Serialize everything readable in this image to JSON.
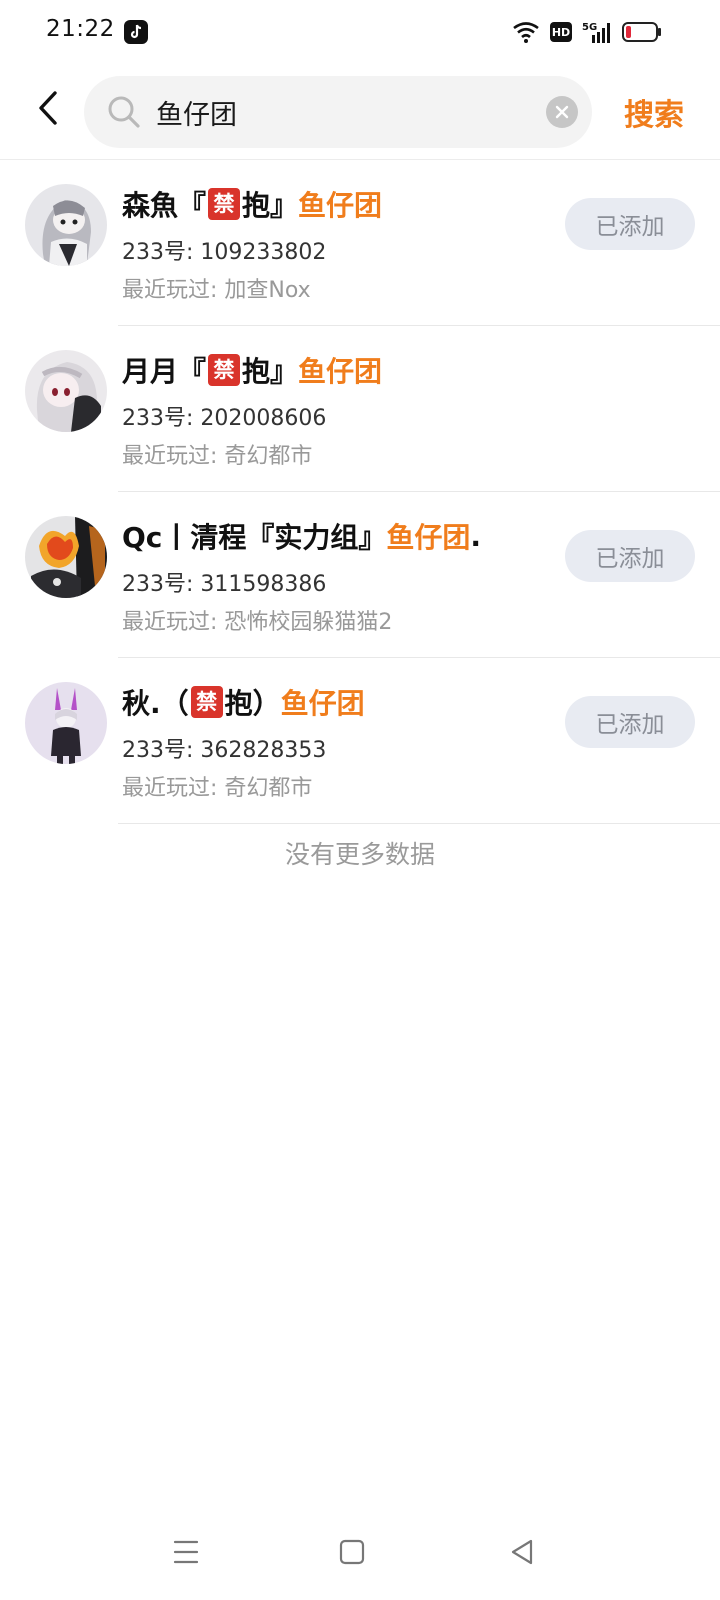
{
  "status_bar": {
    "time": "21:22",
    "icons": [
      "tiktok-icon",
      "wifi-icon",
      "hd-icon",
      "signal-5g-icon",
      "battery-low-icon"
    ],
    "hd_label": "HD",
    "network_label": "5G"
  },
  "search": {
    "query": "鱼仔团",
    "submit_label": "搜索"
  },
  "results": [
    {
      "name_prefix": "森魚『",
      "ban_char": "禁",
      "name_mid": "抱』",
      "name_highlight": "鱼仔团",
      "name_suffix": "",
      "id_text": "233号: 109233802",
      "recent_text": "最近玩过: 加查Nox",
      "action_label": "已添加",
      "has_action": true
    },
    {
      "name_prefix": "月月『",
      "ban_char": "禁",
      "name_mid": "抱』",
      "name_highlight": "鱼仔团",
      "name_suffix": "",
      "id_text": "233号: 202008606",
      "recent_text": "最近玩过: 奇幻都市",
      "action_label": "",
      "has_action": false
    },
    {
      "name_prefix": "Qc丨清程『实力组』",
      "ban_char": "",
      "name_mid": "",
      "name_highlight": "鱼仔团",
      "name_suffix": ".",
      "id_text": "233号: 311598386",
      "recent_text": "最近玩过: 恐怖校园躲猫猫2",
      "action_label": "已添加",
      "has_action": true
    },
    {
      "name_prefix": "秋.（",
      "ban_char": "禁",
      "name_mid": "抱）",
      "name_highlight": "鱼仔团",
      "name_suffix": "",
      "id_text": "233号: 362828353",
      "recent_text": "最近玩过: 奇幻都市",
      "action_label": "已添加",
      "has_action": true
    }
  ],
  "footer_text": "没有更多数据",
  "colors": {
    "accent": "#f07d1c",
    "ban_badge": "#d9342b",
    "added_button_bg": "#e8ebf2"
  }
}
